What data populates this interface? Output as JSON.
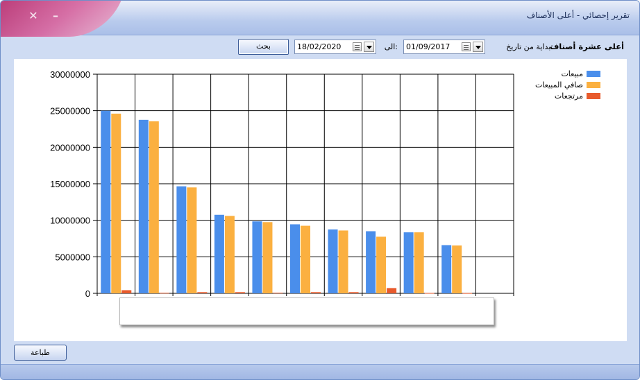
{
  "window": {
    "title": "تقرير إحصائي - أعلى الأصناف",
    "close_glyph": "✕",
    "minimize_glyph": "–"
  },
  "toolbar": {
    "title": "أعلى عشرة أصناف",
    "from_label": "بداية من تاريخ:",
    "from_date": "01/09/2017",
    "to_label": "الى:",
    "to_date": "18/02/2020",
    "search_label": "بحث"
  },
  "footer": {
    "print_label": "طباعة"
  },
  "colors": {
    "sales": "#4a8eeb",
    "net_sales": "#fbb040",
    "returns": "#e85a2c"
  },
  "icons": {
    "calendar": "calendar-icon",
    "dropdown": "chevron-down-icon"
  },
  "chart_data": {
    "type": "bar",
    "categories": [
      "",
      "",
      "",
      "",
      "",
      "",
      "",
      "",
      "",
      "",
      ""
    ],
    "ylim": [
      0,
      30000000
    ],
    "yticks": [
      "30000000",
      "25000000",
      "20000000",
      "15000000",
      "10000000",
      "5000000",
      "0"
    ],
    "grid": true,
    "legend_position": "top-right",
    "series": [
      {
        "name": "مبيعات",
        "color_key": "sales",
        "values": [
          25000000,
          23750000,
          14650000,
          10750000,
          9850000,
          9450000,
          8750000,
          8500000,
          8350000,
          6600000,
          0
        ]
      },
      {
        "name": "صافي المبيعات",
        "color_key": "net_sales",
        "values": [
          24600000,
          23550000,
          14500000,
          10600000,
          9750000,
          9250000,
          8600000,
          7750000,
          8350000,
          6550000,
          0
        ]
      },
      {
        "name": "مرتجعات",
        "color_key": "returns",
        "values": [
          430000,
          70000,
          160000,
          160000,
          80000,
          160000,
          160000,
          720000,
          50000,
          40000,
          0
        ]
      }
    ]
  }
}
